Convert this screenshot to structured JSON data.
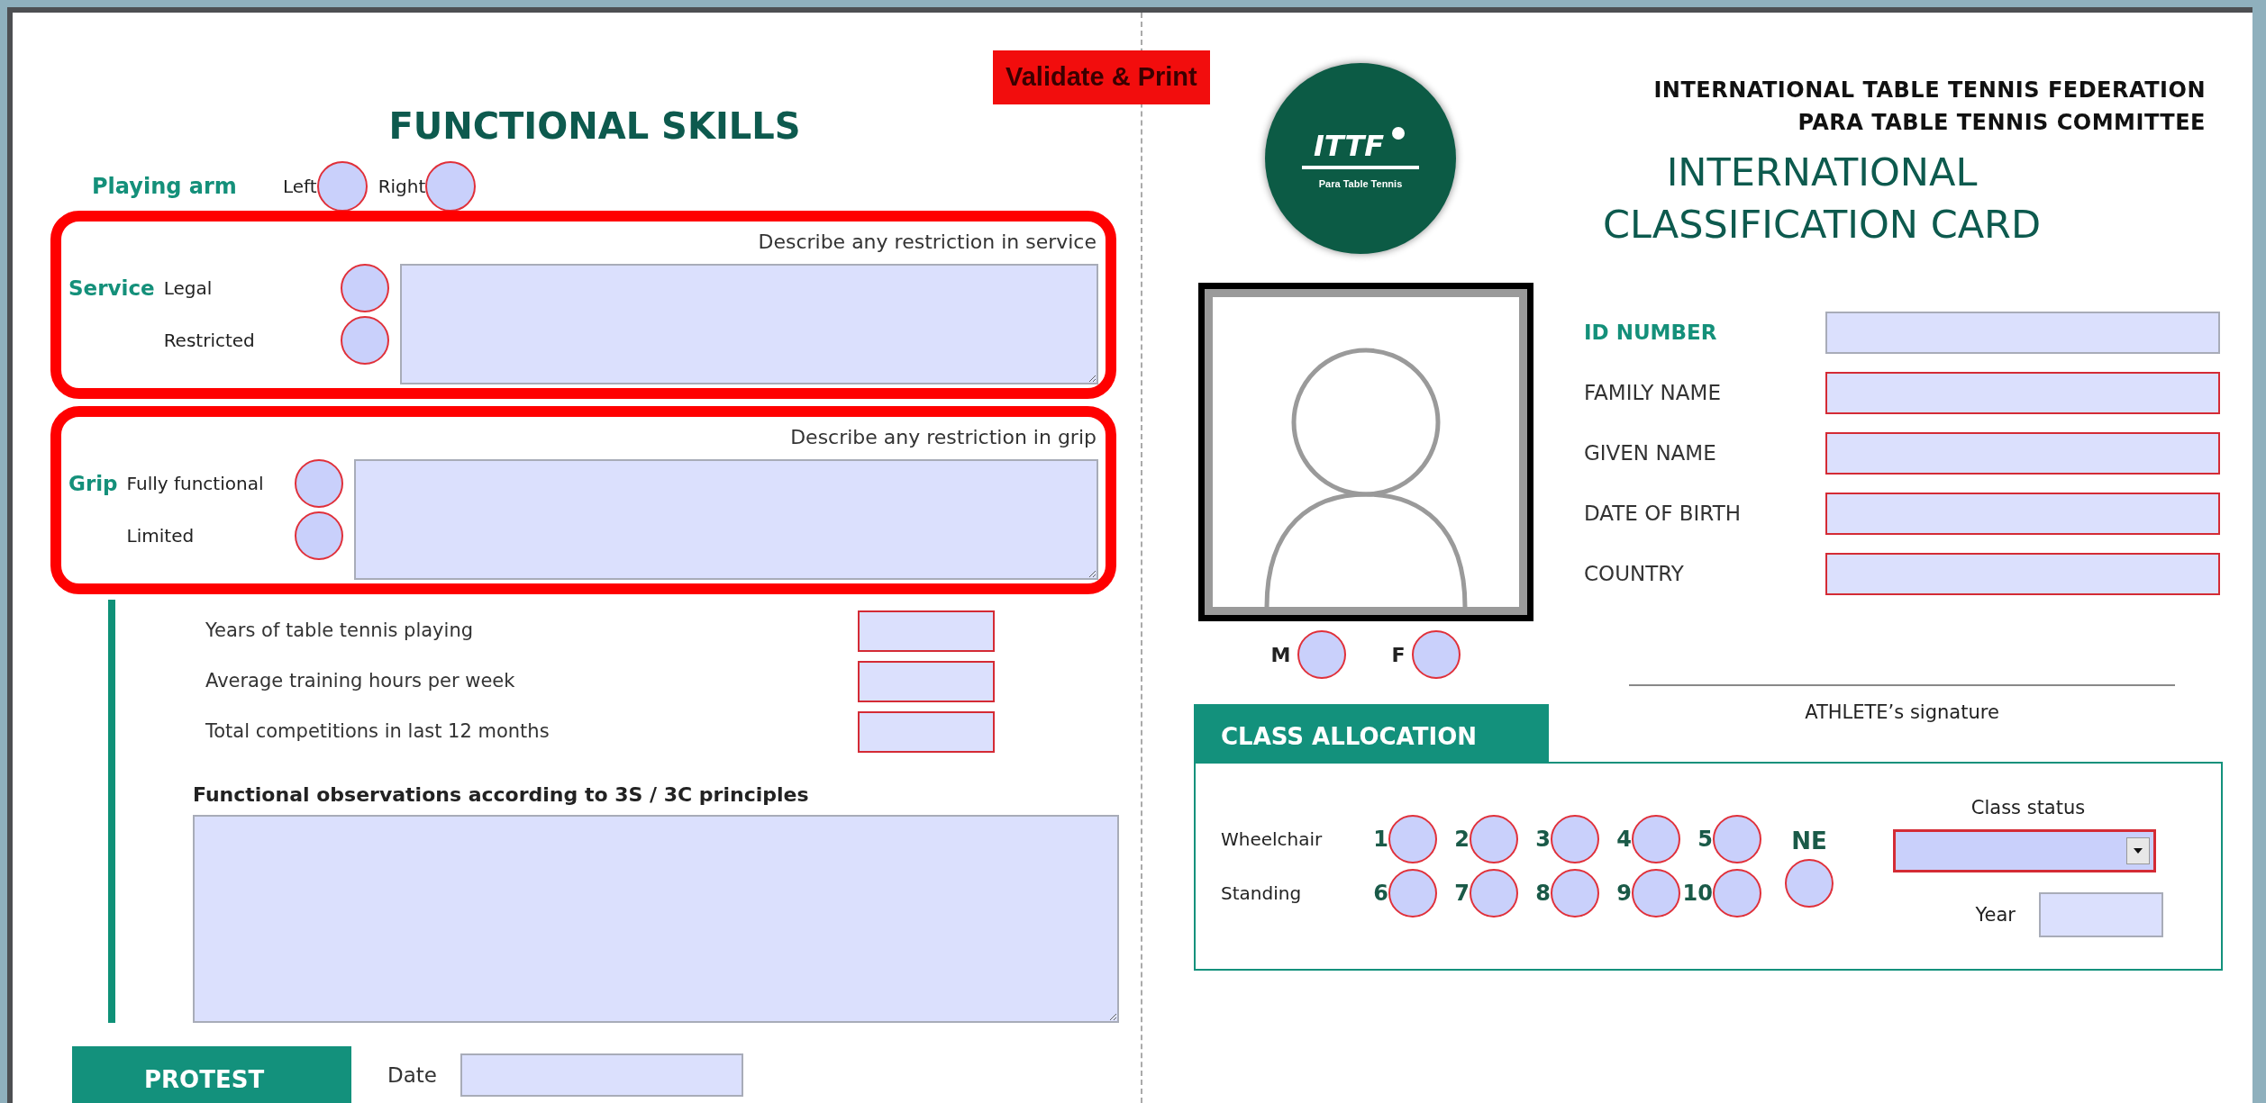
{
  "validate_button": "Validate & Print",
  "functional_skills": {
    "title": "FUNCTIONAL SKILLS",
    "playing_arm": {
      "label": "Playing arm",
      "options": [
        {
          "label": "Left",
          "selected": false
        },
        {
          "label": "Right",
          "selected": false
        }
      ]
    },
    "service": {
      "label": "Service",
      "hint": "Describe any restriction in service",
      "options": [
        {
          "label": "Legal",
          "selected": false
        },
        {
          "label": "Restricted",
          "selected": false
        }
      ]
    },
    "grip": {
      "label": "Grip",
      "hint": "Describe any restriction in grip",
      "options": [
        {
          "label": "Fully functional",
          "selected": false
        },
        {
          "label": "Limited",
          "selected": false
        }
      ]
    },
    "stats": [
      {
        "label": "Years of table tennis playing",
        "required": true
      },
      {
        "label": "Average training hours per week",
        "required": true
      },
      {
        "label": "Total competitions in last 12 months",
        "required": true
      }
    ],
    "observations": {
      "label": "Functional observations according to 3S / 3C principles"
    }
  },
  "protest": {
    "title": "PROTEST",
    "date_label": "Date"
  },
  "header": {
    "organization": "INTERNATIONAL TABLE TENNIS FEDERATION",
    "committee": "PARA TABLE TENNIS COMMITTEE",
    "logo": {
      "mark": "ITTF",
      "caption": "Para Table Tennis"
    },
    "card_title": [
      "INTERNATIONAL",
      "CLASSIFICATION CARD"
    ]
  },
  "identity": {
    "fields": [
      {
        "label": "ID NUMBER",
        "emphasized": true,
        "required": false
      },
      {
        "label": "FAMILY NAME",
        "emphasized": false,
        "required": true
      },
      {
        "label": "GIVEN NAME",
        "emphasized": false,
        "required": true
      },
      {
        "label": "DATE OF BIRTH",
        "emphasized": false,
        "required": true
      },
      {
        "label": "COUNTRY",
        "emphasized": false,
        "required": true
      }
    ],
    "sex": [
      {
        "label": "M",
        "selected": false
      },
      {
        "label": "F",
        "selected": false
      }
    ]
  },
  "signature": {
    "label": "ATHLETE’s signature"
  },
  "class_allocation": {
    "title": "CLASS ALLOCATION",
    "rows": [
      {
        "label": "Wheelchair",
        "options": [
          {
            "label": "1",
            "selected": false
          },
          {
            "label": "2",
            "selected": false
          },
          {
            "label": "3",
            "selected": false
          },
          {
            "label": "4",
            "selected": false
          },
          {
            "label": "5",
            "selected": false
          }
        ]
      },
      {
        "label": "Standing",
        "options": [
          {
            "label": "6",
            "selected": false
          },
          {
            "label": "7",
            "selected": false
          },
          {
            "label": "8",
            "selected": false
          },
          {
            "label": "9",
            "selected": false
          },
          {
            "label": "10",
            "selected": false
          }
        ]
      }
    ],
    "ne": {
      "label": "NE",
      "selected": false
    },
    "class_status": {
      "label": "Class status",
      "required": true
    },
    "year": {
      "label": "Year"
    }
  }
}
